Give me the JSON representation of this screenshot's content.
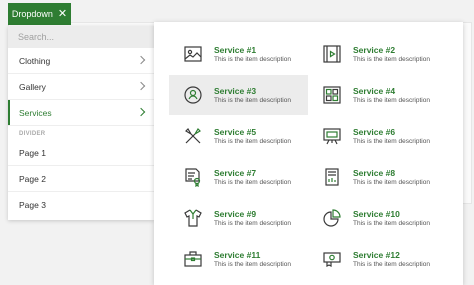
{
  "dropdown_button": {
    "label": "Dropdown",
    "close_glyph": "✕"
  },
  "menu": {
    "search_placeholder": "Search...",
    "items": [
      {
        "label": "Clothing",
        "has_submenu": true,
        "active": false
      },
      {
        "label": "Gallery",
        "has_submenu": true,
        "active": false
      },
      {
        "label": "Services",
        "has_submenu": true,
        "active": true
      }
    ],
    "divider_label": "DIVIDER",
    "pages": [
      {
        "label": "Page 1"
      },
      {
        "label": "Page 2"
      },
      {
        "label": "Page 3"
      }
    ]
  },
  "services": [
    {
      "title": "Service #1",
      "desc": "This is the item description",
      "icon": "image-icon"
    },
    {
      "title": "Service #2",
      "desc": "This is the item description",
      "icon": "film-icon"
    },
    {
      "title": "Service #3",
      "desc": "This is the item description",
      "icon": "user-circle-icon",
      "highlighted": true
    },
    {
      "title": "Service #4",
      "desc": "This is the item description",
      "icon": "dashboard-icon"
    },
    {
      "title": "Service #5",
      "desc": "This is the item description",
      "icon": "tools-icon"
    },
    {
      "title": "Service #6",
      "desc": "This is the item description",
      "icon": "presentation-icon"
    },
    {
      "title": "Service #7",
      "desc": "This is the item description",
      "icon": "certificate-icon"
    },
    {
      "title": "Service #8",
      "desc": "This is the item description",
      "icon": "document-chart-icon"
    },
    {
      "title": "Service #9",
      "desc": "This is the item description",
      "icon": "shirt-icon"
    },
    {
      "title": "Service #10",
      "desc": "This is the item description",
      "icon": "pie-chart-icon"
    },
    {
      "title": "Service #11",
      "desc": "This is the item description",
      "icon": "briefcase-icon"
    },
    {
      "title": "Service #12",
      "desc": "This is the item description",
      "icon": "money-icon"
    }
  ],
  "colors": {
    "accent": "#2e7d32",
    "icon_stroke": "#3a3a3a"
  }
}
